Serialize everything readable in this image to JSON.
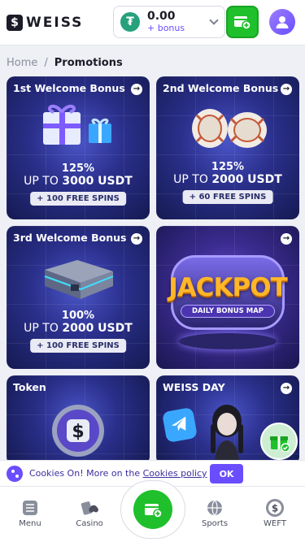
{
  "header": {
    "logo_text": "WEISS",
    "balance_amount": "0.00",
    "balance_bonus": "+ bonus",
    "currency_icon": "tether-icon"
  },
  "breadcrumb": {
    "home": "Home",
    "separator": "/",
    "current": "Promotions"
  },
  "promos": [
    {
      "title": "1st Welcome Bonus",
      "percent": "125%",
      "upto_prefix": "UP TO",
      "upto_amount": "3000 USDT",
      "spins": "+ 100 FREE SPINS",
      "art": "gift-boxes"
    },
    {
      "title": "2nd Welcome Bonus",
      "percent": "125%",
      "upto_prefix": "UP TO",
      "upto_amount": "2000 USDT",
      "spins": "+ 60 FREE SPINS",
      "art": "casino-chips"
    },
    {
      "title": "3rd Welcome Bonus",
      "percent": "100%",
      "upto_prefix": "UP TO",
      "upto_amount": "2000 USDT",
      "spins": "+ 100 FREE SPINS",
      "art": "treasure-case"
    },
    {
      "title": "",
      "jackpot_text": "JACKPOT",
      "jackpot_sub": "DAILY BONUS MAP",
      "art": "jackpot-sign"
    },
    {
      "title": "Token",
      "art": "weiss-token-coin"
    },
    {
      "title": "WEISS DAY",
      "art": "telegram-character"
    }
  ],
  "cookie": {
    "text": "Cookies On! More on the ",
    "link": "Cookies policy",
    "ok": "OK"
  },
  "bottom_nav": {
    "menu": "Menu",
    "casino": "Casino",
    "sports": "Sports",
    "weft": "WEFT"
  },
  "colors": {
    "accent": "#6a4dff",
    "deposit_green": "#1fc02c",
    "card_dark": "#151a52"
  }
}
